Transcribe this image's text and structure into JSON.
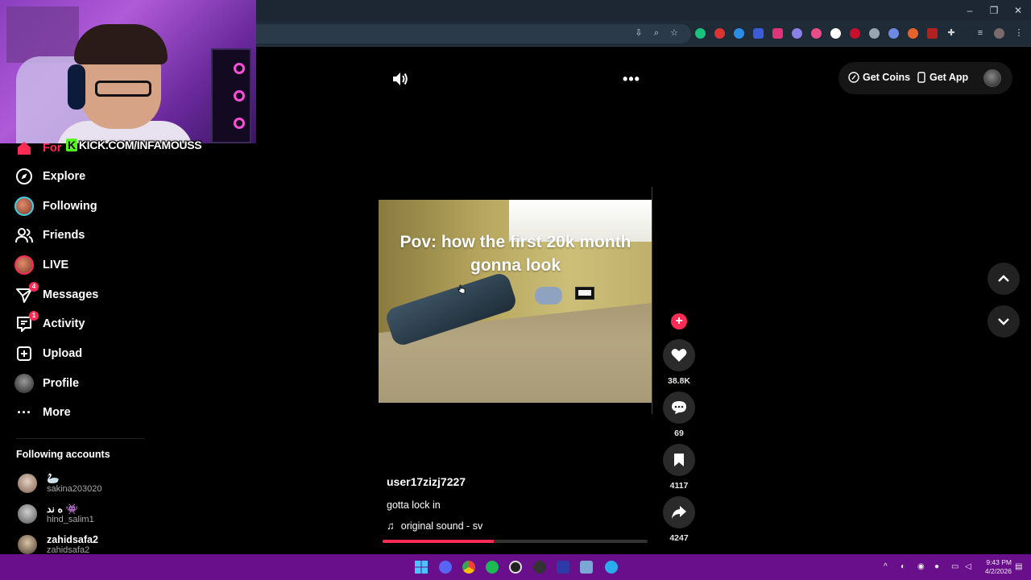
{
  "overlay": {
    "kick_url": "KICK.COM/INFAMOUSS"
  },
  "sidebar": {
    "partial_item": "For",
    "items": [
      {
        "label": "Explore",
        "icon": "compass-icon",
        "badge": ""
      },
      {
        "label": "Following",
        "icon": "avatar",
        "badge": ""
      },
      {
        "label": "Friends",
        "icon": "friends-icon",
        "badge": ""
      },
      {
        "label": "LIVE",
        "icon": "live-avatar",
        "badge": ""
      },
      {
        "label": "Messages",
        "icon": "messages-icon",
        "badge": "4"
      },
      {
        "label": "Activity",
        "icon": "activity-icon",
        "badge": "1"
      },
      {
        "label": "Upload",
        "icon": "upload-icon",
        "badge": ""
      },
      {
        "label": "Profile",
        "icon": "profile-avatar",
        "badge": ""
      },
      {
        "label": "More",
        "icon": "more-icon",
        "badge": ""
      }
    ],
    "following_title": "Following accounts",
    "accounts": [
      {
        "name": "🦢",
        "handle": "sakina203020"
      },
      {
        "name": "ه ند 👾",
        "handle": "hind_salim1"
      },
      {
        "name": "zahidsafa2",
        "handle": "zahidsafa2"
      }
    ]
  },
  "header": {
    "get_coins": "Get Coins",
    "get_app": "Get App"
  },
  "video": {
    "caption": "Pov: how the first 20k month gonna look",
    "author": "user17zizj7227",
    "description": "gotta lock in",
    "sound": "original sound - sv",
    "progress": 0.42
  },
  "actions": {
    "likes": "38.8K",
    "comments": "69",
    "saves": "4117",
    "shares": "4247"
  },
  "taskbar": {
    "time": "9:43 PM",
    "date": "4/2/2026"
  },
  "colors": {
    "accent": "#fe2c55",
    "taskbar": "#6a0f8c",
    "kick_green": "#53fc18"
  }
}
